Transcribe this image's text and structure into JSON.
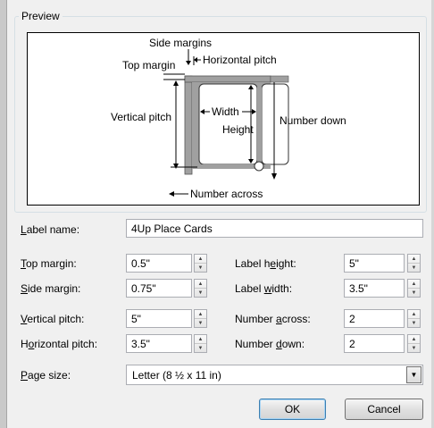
{
  "preview": {
    "legend": "Preview",
    "side_margins": "Side margins",
    "top_margin": "Top margin",
    "horizontal_pitch": "Horizontal pitch",
    "vertical_pitch": "Vertical pitch",
    "width": "Width",
    "height": "Height",
    "number_down": "Number down",
    "number_across": "Number across"
  },
  "form": {
    "label_name": {
      "pre": "",
      "key": "L",
      "post": "abel name:",
      "value": "4Up Place Cards"
    },
    "top_margin": {
      "pre": "",
      "key": "T",
      "post": "op margin:",
      "value": "0.5\""
    },
    "side_margin": {
      "pre": "",
      "key": "S",
      "post": "ide margin:",
      "value": "0.75\""
    },
    "vertical_pitch": {
      "pre": "",
      "key": "V",
      "post": "ertical pitch:",
      "value": "5\""
    },
    "horizontal_pitch": {
      "pre": "H",
      "key": "o",
      "post": "rizontal pitch:",
      "value": "3.5\""
    },
    "label_height": {
      "pre": "Label h",
      "key": "e",
      "post": "ight:",
      "value": "5\""
    },
    "label_width": {
      "pre": "Label ",
      "key": "w",
      "post": "idth:",
      "value": "3.5\""
    },
    "number_across": {
      "pre": "Number ",
      "key": "a",
      "post": "cross:",
      "value": "2"
    },
    "number_down": {
      "pre": "Number ",
      "key": "d",
      "post": "own:",
      "value": "2"
    },
    "page_size": {
      "pre": "",
      "key": "P",
      "post": "age size:",
      "value": "Letter (8 ½ x 11 in)"
    }
  },
  "buttons": {
    "ok": "OK",
    "cancel": "Cancel"
  },
  "icons": {
    "spin_up": "spin-up-arrow",
    "spin_down": "spin-down-arrow",
    "dropdown": "chevron-down"
  },
  "colors": {
    "dialog_bg": "#f0f0f0",
    "field_border": "#abadb3",
    "default_button_border": "#3c7fb1"
  }
}
